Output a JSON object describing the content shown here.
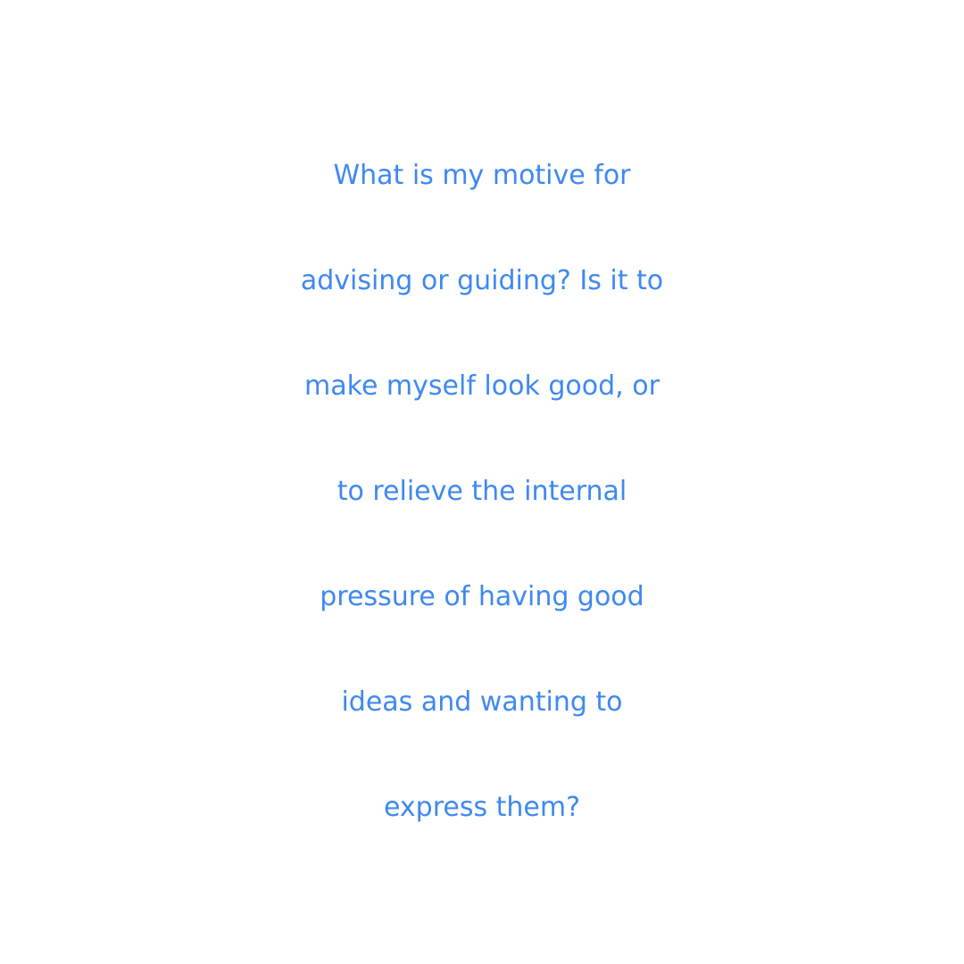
{
  "quote": {
    "lines": [
      "What is my motive for",
      "advising or guiding? Is it to",
      "make myself look good, or",
      "to relieve the internal",
      "pressure of having good",
      "ideas and wanting to",
      "express them?"
    ]
  },
  "colors": {
    "text": "#3f88f2",
    "background": "#ffffff"
  }
}
